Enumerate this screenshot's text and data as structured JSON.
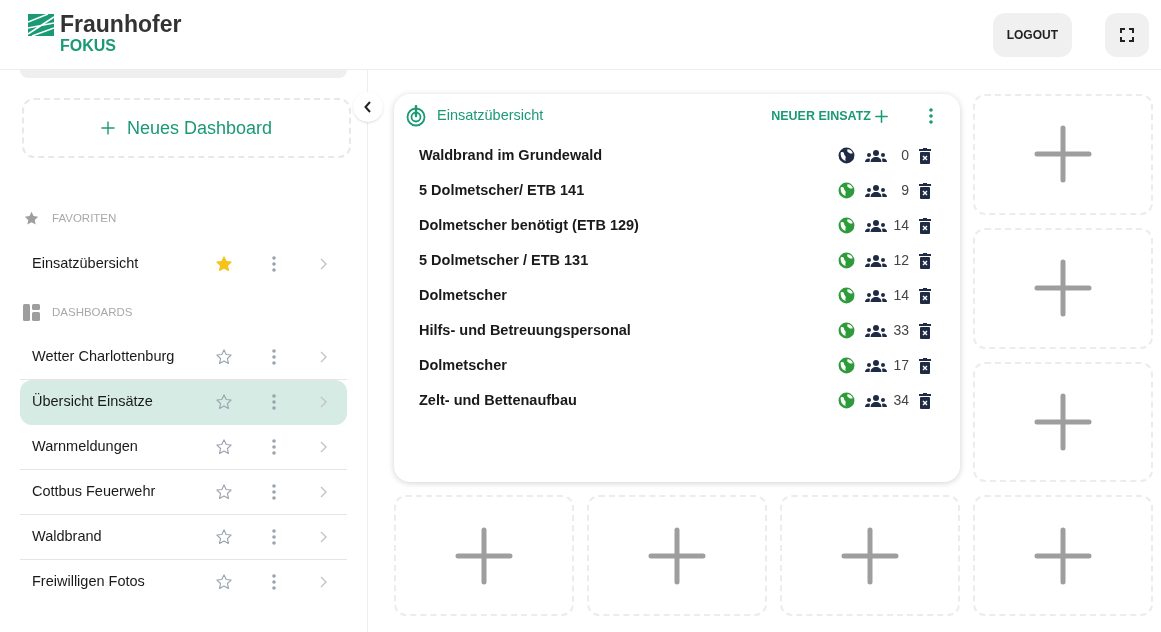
{
  "logo": {
    "name": "Fraunhofer",
    "sub": "FOKUS"
  },
  "header": {
    "logout": "LOGOUT"
  },
  "sidebar": {
    "new_dashboard": "Neues Dashboard",
    "favorites": {
      "title": "FAVORITEN",
      "items": [
        {
          "label": "Einsatzübersicht",
          "favorite": true,
          "selected": false
        }
      ]
    },
    "dashboards": {
      "title": "DASHBOARDS",
      "items": [
        {
          "label": "Wetter Charlottenburg",
          "favorite": false,
          "selected": false
        },
        {
          "label": "Übersicht Einsätze",
          "favorite": false,
          "selected": true
        },
        {
          "label": "Warnmeldungen",
          "favorite": false,
          "selected": false
        },
        {
          "label": "Cottbus Feuerwehr",
          "favorite": false,
          "selected": false
        },
        {
          "label": "Waldbrand",
          "favorite": false,
          "selected": false
        },
        {
          "label": "Freiwilligen Fotos",
          "favorite": false,
          "selected": false
        }
      ]
    }
  },
  "widget": {
    "title": "Einsatzübersicht",
    "action": "NEUER EINSATZ",
    "rows": [
      {
        "name": "Waldbrand im Grundewald",
        "count": "0",
        "color": "#1f2a44"
      },
      {
        "name": "5 Dolmetscher/ ETB 141",
        "count": "9",
        "color": "#2e9b3a"
      },
      {
        "name": "Dolmetscher benötigt (ETB 129)",
        "count": "14",
        "color": "#2e9b3a"
      },
      {
        "name": "5 Dolmetscher / ETB 131",
        "count": "12",
        "color": "#2e9b3a"
      },
      {
        "name": "Dolmetscher",
        "count": "14",
        "color": "#2e9b3a"
      },
      {
        "name": "Hilfs- und Betreuungspersonal",
        "count": "33",
        "color": "#2e9b3a"
      },
      {
        "name": "Dolmetscher",
        "count": "17",
        "color": "#2e9b3a"
      },
      {
        "name": "Zelt- und Bettenaufbau",
        "count": "34",
        "color": "#2e9b3a"
      }
    ]
  }
}
